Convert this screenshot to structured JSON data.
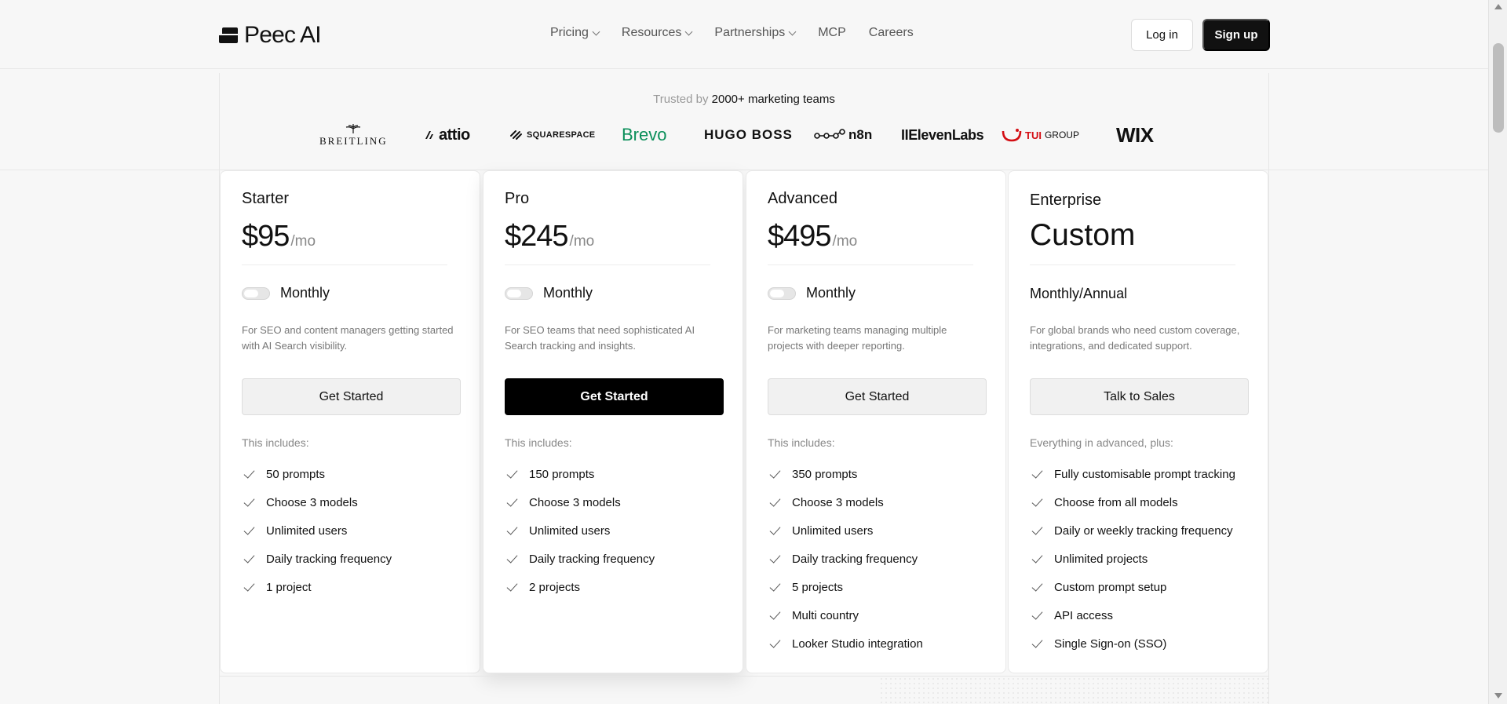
{
  "brand": {
    "name": "Peec AI"
  },
  "nav": [
    {
      "label": "Pricing",
      "has_dropdown": true
    },
    {
      "label": "Resources",
      "has_dropdown": true
    },
    {
      "label": "Partnerships",
      "has_dropdown": true
    },
    {
      "label": "MCP",
      "has_dropdown": false
    },
    {
      "label": "Careers",
      "has_dropdown": false
    }
  ],
  "auth": {
    "login": "Log in",
    "signup": "Sign up"
  },
  "trusted": {
    "prefix": "Trusted by",
    "highlight": "2000+ marketing teams"
  },
  "logos": [
    {
      "name": "BREITLING"
    },
    {
      "name": "attio"
    },
    {
      "name": "SQUARESPACE"
    },
    {
      "name": "Brevo",
      "color": "#0b8f5a"
    },
    {
      "name": "HUGO BOSS"
    },
    {
      "name": "n8n"
    },
    {
      "name": "IIElevenLabs"
    },
    {
      "name": "TUI",
      "suffix": "GROUP",
      "color": "#d40e14"
    },
    {
      "name": "WIX"
    }
  ],
  "plans": [
    {
      "name": "Starter",
      "price": "$95",
      "per": "/mo",
      "billing": "Monthly",
      "description": "For SEO and content managers getting started with AI Search visibility.",
      "cta": "Get Started",
      "includes": "This includes:",
      "features": [
        "50 prompts",
        "Choose 3 models",
        "Unlimited users",
        "Daily tracking frequency",
        "1 project"
      ]
    },
    {
      "name": "Pro",
      "price": "$245",
      "per": "/mo",
      "billing": "Monthly",
      "description": "For SEO teams that need sophisticated AI Search tracking and insights.",
      "cta": "Get Started",
      "includes": "This includes:",
      "features": [
        "150 prompts",
        "Choose 3 models",
        "Unlimited users",
        "Daily tracking frequency",
        "2 projects"
      ]
    },
    {
      "name": "Advanced",
      "price": "$495",
      "per": "/mo",
      "billing": "Monthly",
      "description": "For marketing teams managing multiple projects with deeper reporting.",
      "cta": "Get Started",
      "includes": "This includes:",
      "features": [
        "350 prompts",
        "Choose 3 models",
        "Unlimited users",
        "Daily tracking frequency",
        "5 projects",
        "Multi country",
        "Looker Studio integration"
      ]
    },
    {
      "name": "Enterprise",
      "price": "Custom",
      "billing": "Monthly/Annual",
      "description": "For global brands who need custom coverage, integrations, and dedicated support.",
      "cta": "Talk to Sales",
      "includes": "Everything in advanced, plus:",
      "features": [
        "Fully customisable prompt tracking",
        "Choose from all models",
        "Daily or weekly tracking frequency",
        "Unlimited projects",
        "Custom prompt setup",
        "API access",
        "Single Sign-on (SSO)"
      ]
    }
  ]
}
